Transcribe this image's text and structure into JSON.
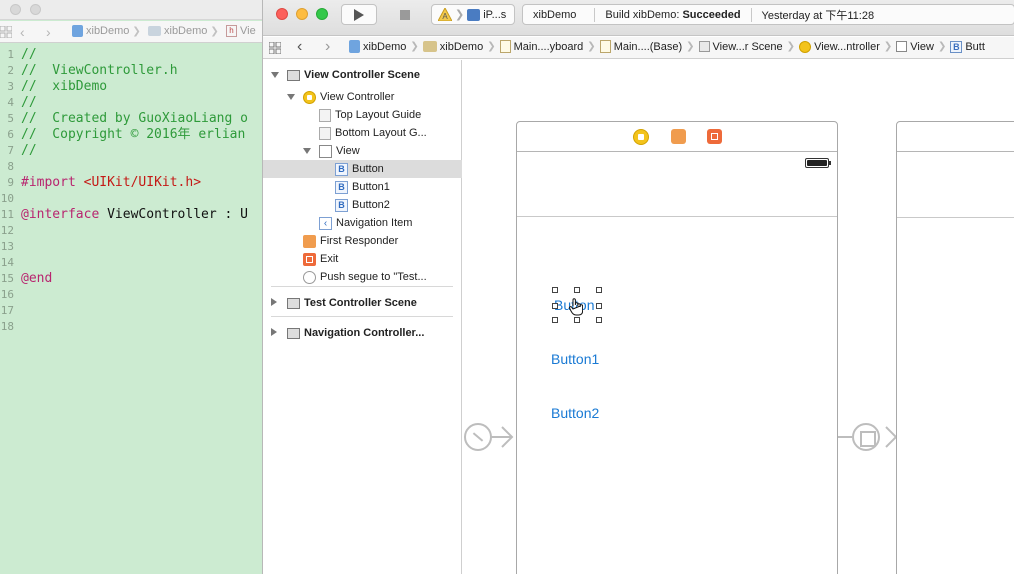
{
  "background_window": {
    "jumpbar": {
      "project": "xibDemo",
      "folder": "xibDemo",
      "file": "Vie"
    },
    "code_lines": [
      {
        "num": "1",
        "parts": [
          {
            "t": "//",
            "c": "c-comment"
          }
        ]
      },
      {
        "num": "2",
        "parts": [
          {
            "t": "//  ViewController.h",
            "c": "c-comment"
          }
        ]
      },
      {
        "num": "3",
        "parts": [
          {
            "t": "//  xibDemo",
            "c": "c-comment"
          }
        ]
      },
      {
        "num": "4",
        "parts": [
          {
            "t": "//",
            "c": "c-comment"
          }
        ]
      },
      {
        "num": "5",
        "parts": [
          {
            "t": "//  Created by GuoXiaoLiang o",
            "c": "c-comment"
          }
        ]
      },
      {
        "num": "6",
        "parts": [
          {
            "t": "//  Copyright © 2016年 erlian",
            "c": "c-comment"
          }
        ]
      },
      {
        "num": "7",
        "parts": [
          {
            "t": "//",
            "c": "c-comment"
          }
        ]
      },
      {
        "num": "8",
        "parts": []
      },
      {
        "num": "9",
        "parts": [
          {
            "t": "#import ",
            "c": "c-kw"
          },
          {
            "t": "<UIKit/UIKit.h>",
            "c": "c-str"
          }
        ]
      },
      {
        "num": "10",
        "parts": []
      },
      {
        "num": "11",
        "parts": [
          {
            "t": "@interface",
            "c": "c-kw"
          },
          {
            "t": " ViewController : U",
            "c": "c-plain"
          }
        ]
      },
      {
        "num": "12",
        "parts": []
      },
      {
        "num": "13",
        "parts": []
      },
      {
        "num": "14",
        "parts": []
      },
      {
        "num": "15",
        "parts": [
          {
            "t": "@end",
            "c": "c-kw"
          }
        ]
      },
      {
        "num": "16",
        "parts": []
      },
      {
        "num": "17",
        "parts": []
      },
      {
        "num": "18",
        "parts": []
      }
    ]
  },
  "toolbar": {
    "scheme_device": "iP...s",
    "activity_project": "xibDemo",
    "activity_status_prefix": "Build xibDemo: ",
    "activity_status_result": "Succeeded",
    "activity_time": "Yesterday at 下午11:28"
  },
  "jumpbar": {
    "items": [
      {
        "icon": "project-icon",
        "label": "xibDemo"
      },
      {
        "icon": "folder-icon",
        "label": "xibDemo"
      },
      {
        "icon": "storyboard-icon",
        "label": "Main....yboard"
      },
      {
        "icon": "storyboard-icon",
        "label": "Main....(Base)"
      },
      {
        "icon": "scene-icon",
        "label": "View...r Scene"
      },
      {
        "icon": "view-controller-icon",
        "label": "View...ntroller"
      },
      {
        "icon": "view-icon",
        "label": "View"
      },
      {
        "icon": "button-icon",
        "label": "Butt"
      }
    ]
  },
  "outline": {
    "items": [
      {
        "label": "View Controller Scene",
        "bold": true,
        "icon": "scene-icon",
        "disclosure": "open",
        "depth": 0
      },
      {
        "label": "View Controller",
        "icon": "view-controller-icon",
        "disclosure": "open",
        "depth": 1
      },
      {
        "label": "Top Layout Guide",
        "icon": "layout-guide-icon",
        "depth": 2
      },
      {
        "label": "Bottom Layout G...",
        "icon": "layout-guide-icon",
        "depth": 2
      },
      {
        "label": "View",
        "icon": "view-icon",
        "disclosure": "open",
        "depth": 2
      },
      {
        "label": "Button",
        "icon": "button-icon",
        "depth": 3,
        "selected": true
      },
      {
        "label": "Button1",
        "icon": "button-icon",
        "depth": 3
      },
      {
        "label": "Button2",
        "icon": "button-icon",
        "depth": 3
      },
      {
        "label": "Navigation Item",
        "icon": "navigation-item-icon",
        "depth": 2
      },
      {
        "label": "First Responder",
        "icon": "first-responder-icon",
        "depth": 1
      },
      {
        "label": "Exit",
        "icon": "exit-icon",
        "depth": 1
      },
      {
        "label": "Push segue to \"Test...",
        "icon": "segue-icon",
        "depth": 1
      },
      {
        "label": "Test Controller Scene",
        "bold": true,
        "icon": "scene-icon",
        "disclosure": "closed",
        "depth": 0
      },
      {
        "label": "Navigation Controller...",
        "bold": true,
        "icon": "scene-icon",
        "disclosure": "closed",
        "depth": 0
      }
    ]
  },
  "canvas": {
    "buttons": {
      "button": "Button",
      "button1": "Button1",
      "button2": "Button2"
    },
    "accent_color": "#1a7ad4"
  }
}
